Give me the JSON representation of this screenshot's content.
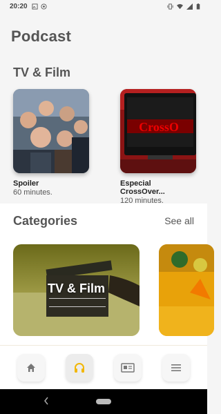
{
  "status_bar": {
    "time": "20:20"
  },
  "header": {
    "title": "Podcast"
  },
  "tv_film": {
    "title": "TV & Film",
    "cards": [
      {
        "name": "Spoiler",
        "duration": "60 minutes."
      },
      {
        "name": "Especial CrossOver...",
        "duration": "120 minutes."
      }
    ]
  },
  "categories": {
    "title": "Categories",
    "see_all": "See all",
    "items": [
      {
        "label": "TV & Film"
      },
      {
        "label": ""
      }
    ]
  },
  "nav": {
    "items": [
      {
        "icon": "home-icon",
        "active": false
      },
      {
        "icon": "headphones-icon",
        "active": true
      },
      {
        "icon": "news-icon",
        "active": false
      },
      {
        "icon": "menu-icon",
        "active": false
      }
    ]
  },
  "colors": {
    "accent": "#f2b705",
    "background": "#f5f5f5"
  }
}
